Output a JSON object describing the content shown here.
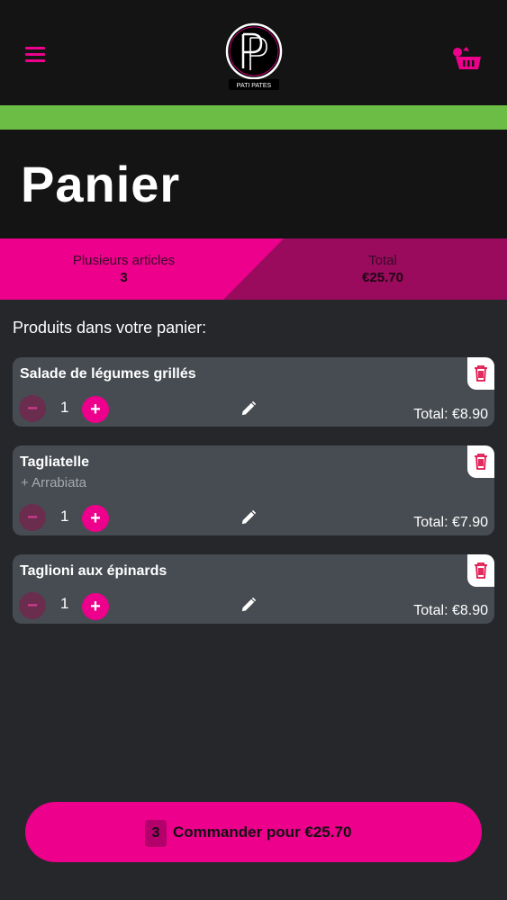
{
  "header": {
    "logo_text": "PATI PATES"
  },
  "page": {
    "title": "Panier"
  },
  "summary": {
    "articles_label": "Plusieurs articles",
    "articles_count": "3",
    "total_label": "Total",
    "total_value": "€25.70"
  },
  "cart": {
    "heading": "Produits dans votre panier:",
    "items": [
      {
        "name": "Salade de légumes grillés",
        "option": "",
        "quantity": "1",
        "total": "Total: €8.90"
      },
      {
        "name": "Tagliatelle",
        "option": "+ Arrabiata",
        "quantity": "1",
        "total": "Total: €7.90"
      },
      {
        "name": "Taglioni aux épinards",
        "option": "",
        "quantity": "1",
        "total": "Total: €8.90"
      }
    ],
    "minus_symbol": "−",
    "plus_symbol": "+"
  },
  "checkout": {
    "count": "3",
    "label": "Commander pour €25.70"
  },
  "colors": {
    "accent": "#ec008c",
    "green_bar": "#6cbd45",
    "background": "#25272b",
    "card": "#474c52"
  }
}
